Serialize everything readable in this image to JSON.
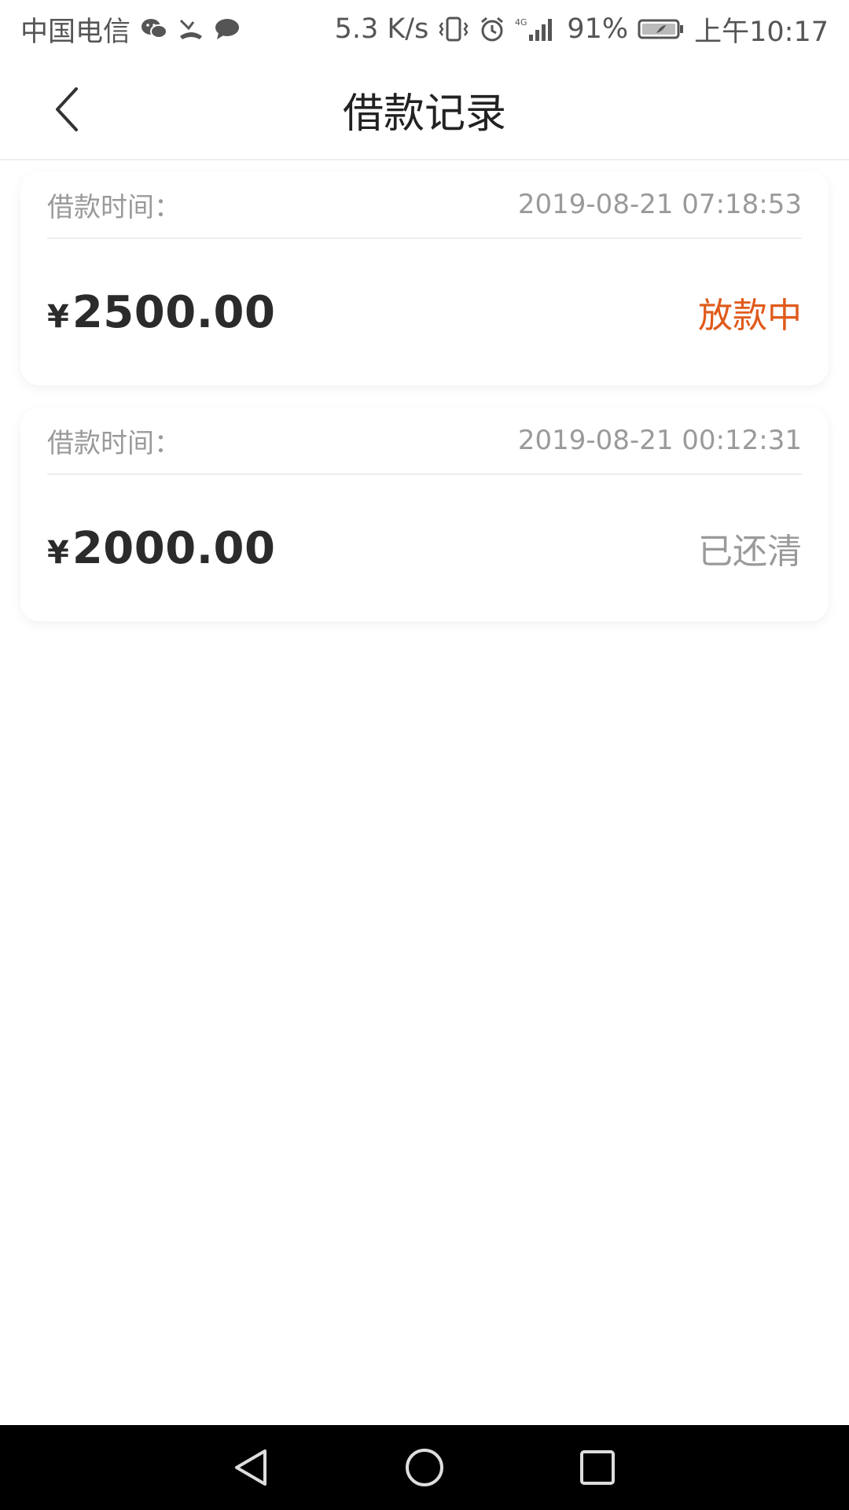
{
  "status_bar": {
    "carrier": "中国电信",
    "net_speed": "5.3 K/s",
    "signal_type": "4G",
    "battery": "91%",
    "time": "上午10:17"
  },
  "header": {
    "title": "借款记录"
  },
  "records": [
    {
      "label": "借款时间：",
      "time": "2019-08-21 07:18:53",
      "currency": "¥",
      "amount": "2500.00",
      "status": "放款中",
      "status_color": "#e05a1a"
    },
    {
      "label": "借款时间：",
      "time": "2019-08-21 00:12:31",
      "currency": "¥",
      "amount": "2000.00",
      "status": "已还清",
      "status_color": "#9a9a9a"
    }
  ],
  "colors": {
    "accent": "#e05a1a",
    "muted": "#9a9a9a",
    "text": "#2b2b2b"
  }
}
